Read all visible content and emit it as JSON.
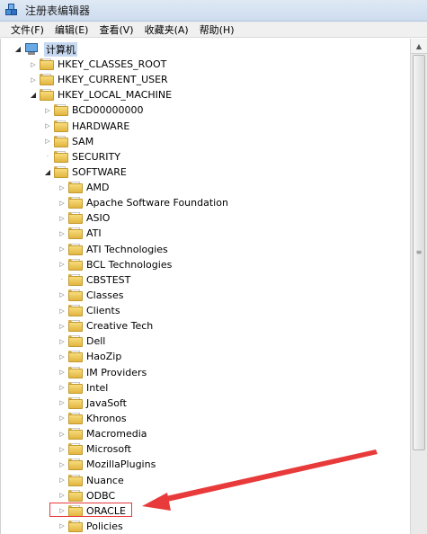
{
  "window": {
    "title": "注册表编辑器",
    "icon": "registry-editor-icon"
  },
  "menu": [
    "文件(F)",
    "编辑(E)",
    "查看(V)",
    "收藏夹(A)",
    "帮助(H)"
  ],
  "tree": {
    "root": "计算机",
    "items": [
      {
        "label": "HKEY_CLASSES_ROOT",
        "depth": 1,
        "expander": "collapsed"
      },
      {
        "label": "HKEY_CURRENT_USER",
        "depth": 1,
        "expander": "collapsed"
      },
      {
        "label": "HKEY_LOCAL_MACHINE",
        "depth": 1,
        "expander": "expanded"
      },
      {
        "label": "BCD00000000",
        "depth": 2,
        "expander": "collapsed"
      },
      {
        "label": "HARDWARE",
        "depth": 2,
        "expander": "collapsed"
      },
      {
        "label": "SAM",
        "depth": 2,
        "expander": "collapsed"
      },
      {
        "label": "SECURITY",
        "depth": 2,
        "expander": "none"
      },
      {
        "label": "SOFTWARE",
        "depth": 2,
        "expander": "expanded"
      },
      {
        "label": "AMD",
        "depth": 3,
        "expander": "collapsed"
      },
      {
        "label": "Apache Software Foundation",
        "depth": 3,
        "expander": "collapsed"
      },
      {
        "label": "ASIO",
        "depth": 3,
        "expander": "collapsed"
      },
      {
        "label": "ATI",
        "depth": 3,
        "expander": "collapsed"
      },
      {
        "label": "ATI Technologies",
        "depth": 3,
        "expander": "collapsed"
      },
      {
        "label": "BCL Technologies",
        "depth": 3,
        "expander": "collapsed"
      },
      {
        "label": "CBSTEST",
        "depth": 3,
        "expander": "none"
      },
      {
        "label": "Classes",
        "depth": 3,
        "expander": "collapsed"
      },
      {
        "label": "Clients",
        "depth": 3,
        "expander": "collapsed"
      },
      {
        "label": "Creative Tech",
        "depth": 3,
        "expander": "collapsed"
      },
      {
        "label": "Dell",
        "depth": 3,
        "expander": "collapsed"
      },
      {
        "label": "HaoZip",
        "depth": 3,
        "expander": "collapsed"
      },
      {
        "label": "IM Providers",
        "depth": 3,
        "expander": "collapsed"
      },
      {
        "label": "Intel",
        "depth": 3,
        "expander": "collapsed"
      },
      {
        "label": "JavaSoft",
        "depth": 3,
        "expander": "collapsed"
      },
      {
        "label": "Khronos",
        "depth": 3,
        "expander": "collapsed"
      },
      {
        "label": "Macromedia",
        "depth": 3,
        "expander": "collapsed"
      },
      {
        "label": "Microsoft",
        "depth": 3,
        "expander": "collapsed"
      },
      {
        "label": "MozillaPlugins",
        "depth": 3,
        "expander": "collapsed"
      },
      {
        "label": "Nuance",
        "depth": 3,
        "expander": "collapsed"
      },
      {
        "label": "ODBC",
        "depth": 3,
        "expander": "collapsed"
      },
      {
        "label": "ORACLE",
        "depth": 3,
        "expander": "collapsed"
      },
      {
        "label": "Policies",
        "depth": 3,
        "expander": "collapsed"
      }
    ]
  },
  "annotation": {
    "highlighted_item": "ORACLE",
    "color": "#e83a3a"
  }
}
